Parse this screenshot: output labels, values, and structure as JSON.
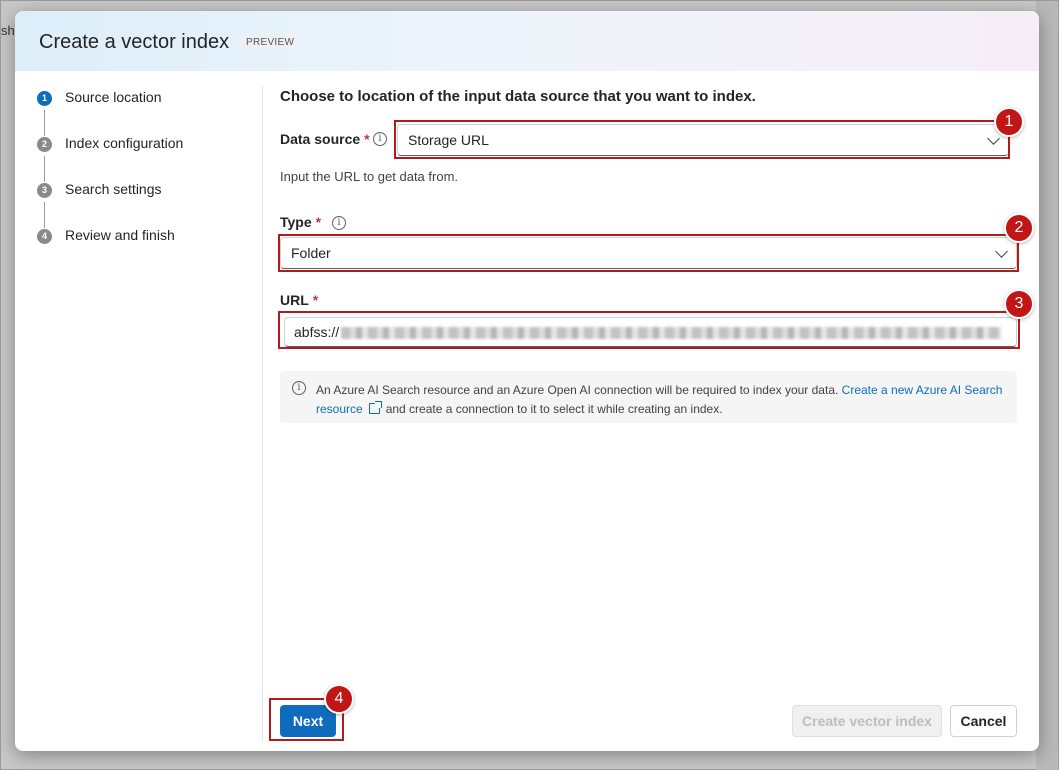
{
  "background": {
    "partial_text": "sh"
  },
  "dialog": {
    "title": "Create a vector index",
    "badge": "PREVIEW"
  },
  "steps": [
    {
      "num": "1",
      "label": "Source location",
      "active": true
    },
    {
      "num": "2",
      "label": "Index configuration",
      "active": false
    },
    {
      "num": "3",
      "label": "Search settings",
      "active": false
    },
    {
      "num": "4",
      "label": "Review and finish",
      "active": false
    }
  ],
  "form": {
    "heading": "Choose to location of the input data source that you want to index.",
    "data_source": {
      "label": "Data source",
      "required": "*",
      "value": "Storage URL",
      "hint": "Input the URL to get data from."
    },
    "type": {
      "label": "Type",
      "required": "*",
      "value": "Folder"
    },
    "url": {
      "label": "URL",
      "required": "*",
      "value_prefix": "abfss://"
    }
  },
  "notice": {
    "text": "An Azure AI Search resource and an Azure Open AI connection will be required to index your data.",
    "link_text": "Create a new Azure AI Search resource",
    "text_after": "and create a connection to it to select it while creating an index."
  },
  "buttons": {
    "next": "Next",
    "create": "Create vector index",
    "cancel": "Cancel"
  },
  "annotations": [
    "1",
    "2",
    "3",
    "4"
  ],
  "colors": {
    "accent": "#0f6cbd",
    "annotation": "#c11616",
    "required": "#c4314b"
  }
}
